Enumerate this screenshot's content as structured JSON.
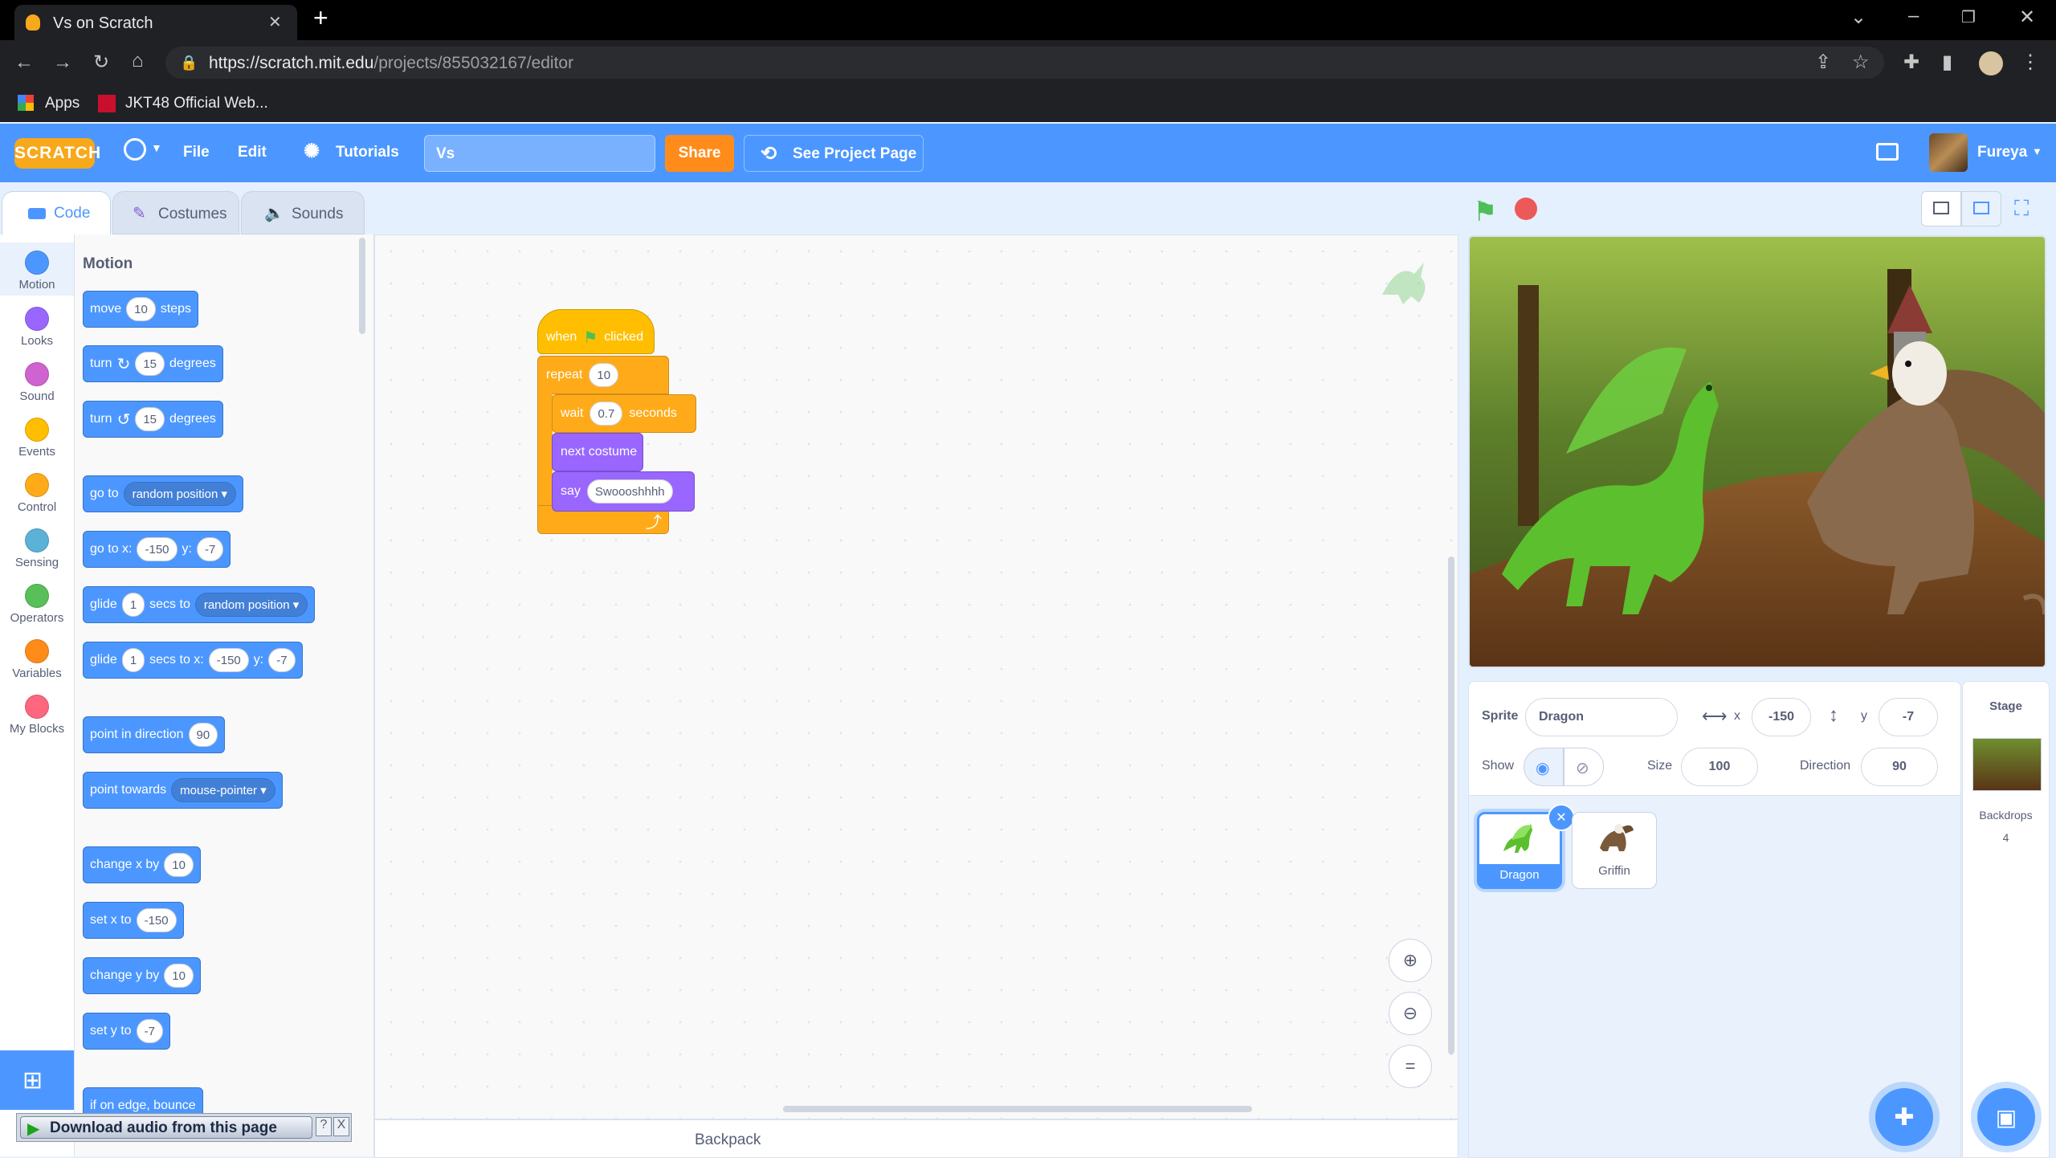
{
  "browser": {
    "tab_title": "Vs on Scratch",
    "tab_close": "✕",
    "new_tab": "+",
    "url_host": "https://scratch.mit.edu",
    "url_path": "/projects/855032167/editor",
    "bookmarks": [
      {
        "label": "Apps",
        "icon": "apps-grid-icon"
      },
      {
        "label": "JKT48 Official Web...",
        "icon": "jkt48-favicon"
      }
    ]
  },
  "menubar": {
    "logo": "SCRATCH",
    "file": "File",
    "edit": "Edit",
    "tutorials": "Tutorials",
    "project_title": "Vs",
    "share": "Share",
    "see_project_page": "See Project Page",
    "username": "Fureya",
    "colors": {
      "bar": "#4c97ff",
      "share": "#ff8c1a"
    }
  },
  "editor_tabs": {
    "code": "Code",
    "costumes": "Costumes",
    "sounds": "Sounds"
  },
  "categories": [
    {
      "label": "Motion",
      "color": "#4c97ff"
    },
    {
      "label": "Looks",
      "color": "#9966ff"
    },
    {
      "label": "Sound",
      "color": "#cf63cf"
    },
    {
      "label": "Events",
      "color": "#ffbf00"
    },
    {
      "label": "Control",
      "color": "#ffab19"
    },
    {
      "label": "Sensing",
      "color": "#5cb1d6"
    },
    {
      "label": "Operators",
      "color": "#59c059"
    },
    {
      "label": "Variables",
      "color": "#ff8c1a"
    },
    {
      "label": "My Blocks",
      "color": "#ff6680"
    }
  ],
  "palette": {
    "heading": "Motion",
    "blocks": {
      "move": {
        "a": "move",
        "v": "10",
        "b": "steps"
      },
      "turn_right": {
        "a": "turn",
        "v": "15",
        "b": "degrees"
      },
      "turn_left": {
        "a": "turn",
        "v": "15",
        "b": "degrees"
      },
      "goto": {
        "a": "go to",
        "d": "random position"
      },
      "goto_xy": {
        "a": "go to x:",
        "x": "-150",
        "b": "y:",
        "y": "-7"
      },
      "glide_to": {
        "a": "glide",
        "v": "1",
        "b": "secs to",
        "d": "random position"
      },
      "glide_xy": {
        "a": "glide",
        "v": "1",
        "b": "secs to x:",
        "x": "-150",
        "c": "y:",
        "y": "-7"
      },
      "point_dir": {
        "a": "point in direction",
        "v": "90"
      },
      "point_towards": {
        "a": "point towards",
        "d": "mouse-pointer"
      },
      "change_x": {
        "a": "change x by",
        "v": "10"
      },
      "set_x": {
        "a": "set x to",
        "v": "-150"
      },
      "change_y": {
        "a": "change y by",
        "v": "10"
      },
      "set_y": {
        "a": "set y to",
        "v": "-7"
      },
      "bounce": {
        "a": "if on edge, bounce"
      }
    }
  },
  "script": {
    "when": "when",
    "clicked": "clicked",
    "repeat": "repeat",
    "repeat_count": "10",
    "wait": "wait",
    "wait_secs": "0.7",
    "seconds": "seconds",
    "next_costume": "next costume",
    "say": "say",
    "say_text": "Swoooshhhh"
  },
  "backpack": "Backpack",
  "download_bar": {
    "label": "Download audio from this page",
    "help": "?",
    "close": "X"
  },
  "sprite_info": {
    "sprite_label": "Sprite",
    "sprite_name": "Dragon",
    "x_label": "x",
    "x": "-150",
    "y_label": "y",
    "y": "-7",
    "show_label": "Show",
    "size_label": "Size",
    "size": "100",
    "direction_label": "Direction",
    "direction": "90"
  },
  "sprites": [
    {
      "name": "Dragon",
      "selected": true
    },
    {
      "name": "Griffin",
      "selected": false
    }
  ],
  "stage_pane": {
    "title": "Stage",
    "backdrops_label": "Backdrops",
    "backdrops_count": "4"
  }
}
